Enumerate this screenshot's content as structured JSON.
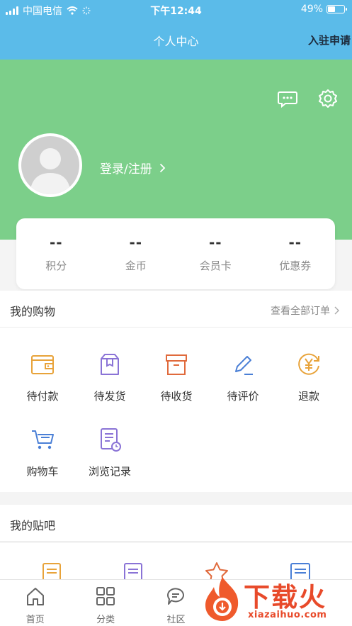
{
  "status_bar": {
    "carrier": "中国电信",
    "time": "下午12:44",
    "battery_text": "49%",
    "battery_level": 0.49
  },
  "nav": {
    "title": "个人中心",
    "action": "入驻申请"
  },
  "profile": {
    "login_text": "登录/注册"
  },
  "stats": [
    {
      "value": "--",
      "label": "积分"
    },
    {
      "value": "--",
      "label": "金币"
    },
    {
      "value": "--",
      "label": "会员卡"
    },
    {
      "value": "--",
      "label": "优惠券"
    }
  ],
  "orders": {
    "title": "我的购物",
    "view_all": "查看全部订单",
    "items": [
      {
        "label": "待付款",
        "icon": "wallet-icon"
      },
      {
        "label": "待发货",
        "icon": "package-icon"
      },
      {
        "label": "待收货",
        "icon": "box-icon"
      },
      {
        "label": "待评价",
        "icon": "pen-icon"
      },
      {
        "label": "退款",
        "icon": "yen-refund-icon"
      },
      {
        "label": "购物车",
        "icon": "cart-icon"
      },
      {
        "label": "浏览记录",
        "icon": "history-icon"
      }
    ]
  },
  "forum": {
    "title": "我的贴吧"
  },
  "tabbar": [
    {
      "label": "首页",
      "icon": "home-icon"
    },
    {
      "label": "分类",
      "icon": "grid-icon"
    },
    {
      "label": "社区",
      "icon": "chat-icon"
    },
    {
      "label": "",
      "icon": "tab-icon-4"
    },
    {
      "label": "",
      "icon": "tab-icon-5"
    }
  ],
  "watermark": {
    "brand": "下载火",
    "site": "xiazaihuo.com"
  },
  "colors": {
    "nav_bg": "#5bbbe9",
    "hero_bg": "#7ccf8a",
    "orange": "#e8a33a",
    "purple": "#8a73d6",
    "red": "#e06a3c",
    "blue": "#4a7fd6"
  }
}
